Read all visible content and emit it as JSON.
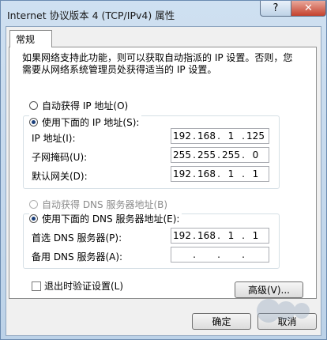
{
  "window": {
    "title": "Internet 协议版本 4 (TCP/IPv4) 属性",
    "help_label": "?",
    "close_label": "✕"
  },
  "tabs": [
    {
      "label": "常规"
    }
  ],
  "description": "如果网络支持此功能，则可以获取自动指派的 IP 设置。否则，您需要从网络系统管理员处获得适当的 IP 设置。",
  "ip_section": {
    "auto_label": "自动获得 IP 地址(O)",
    "manual_label": "使用下面的 IP 地址(S):",
    "fields": [
      {
        "label": "IP 地址(I):",
        "octets": [
          "192",
          "168",
          "1",
          "125"
        ]
      },
      {
        "label": "子网掩码(U):",
        "octets": [
          "255",
          "255",
          "255",
          "0"
        ]
      },
      {
        "label": "默认网关(D):",
        "octets": [
          "192",
          "168",
          "1",
          "1"
        ]
      }
    ]
  },
  "dns_section": {
    "auto_label": "自动获得 DNS 服务器地址(B)",
    "manual_label": "使用下面的 DNS 服务器地址(E):",
    "fields": [
      {
        "label": "首选 DNS 服务器(P):",
        "octets": [
          "192",
          "168",
          "1",
          "1"
        ]
      },
      {
        "label": "备用 DNS 服务器(A):",
        "octets": [
          "",
          "",
          "",
          ""
        ]
      }
    ]
  },
  "validate_label": "退出时验证设置(L)",
  "advanced_label": "高级(V)...",
  "ok_label": "确定",
  "cancel_label": "取消",
  "colors": {
    "titlebar": "#c6d8ea",
    "close": "#c4412d",
    "radio_dot": "#1b3f7a"
  }
}
